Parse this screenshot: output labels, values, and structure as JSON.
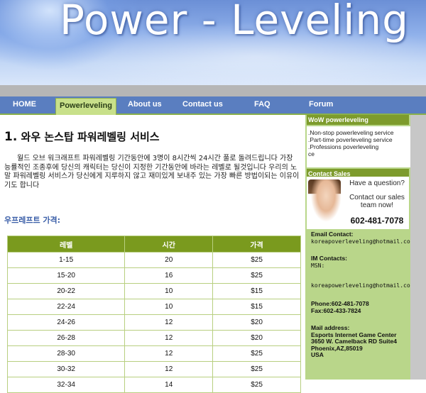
{
  "banner": {
    "title": "Power - Leveling"
  },
  "nav": {
    "home": "HOME",
    "powerleveling": "Powerleveling",
    "about": "About us",
    "contact": "Contact us",
    "faq": "FAQ",
    "forum": "Forum"
  },
  "main": {
    "heading_num": "1.",
    "heading": "와우 논스탑 파워레벨링 서비스",
    "paragraph": "월드 오브 워크래프트 파워레벨링 기간동안에 3명이 8시간씩 24시간 풀로 돌려드립니다 가장 능률적인 조종후에 당신의 캐릭터는 당신이 지정한 기간동안에 바라는 레벨로 될것입니다 우리의 노말 파워레벨링 서비스가 당신에게 지루하지 않고 재미있게 보내주 있는 가장 빠른 방법이되는 이유이기도 합니다",
    "price_heading": "우프레프트 가격:",
    "table": {
      "headers": [
        "레벨",
        "시간",
        "가격"
      ],
      "rows": [
        [
          "1-15",
          "20",
          "$25"
        ],
        [
          "15-20",
          "16",
          "$25"
        ],
        [
          "20-22",
          "10",
          "$15"
        ],
        [
          "22-24",
          "10",
          "$15"
        ],
        [
          "24-26",
          "12",
          "$20"
        ],
        [
          "26-28",
          "12",
          "$20"
        ],
        [
          "28-30",
          "12",
          "$25"
        ],
        [
          "30-32",
          "12",
          "$25"
        ],
        [
          "32-34",
          "14",
          "$25"
        ]
      ]
    }
  },
  "sidebar": {
    "wow_head": "WoW powerleveling",
    "links": [
      ".Non-stop powerleveling service",
      ".Part-time poverleveling service",
      ".Professions poverleveling",
      "ce"
    ],
    "contact_head": "Contact Sales",
    "contact_q": "Have a question?",
    "contact_msg": "Contact our sales team now!",
    "contact_phone": "602-481-7078",
    "email_label": "Email Contact:",
    "email_value": "koreapoverleveling@hotmail.com",
    "im_label": "IM Contacts:",
    "msn_label": "MSN:",
    "msn_value": "koreapowerleveling@hotmail.com",
    "phone_line": "Phone:602-481-7078",
    "fax_line": "Fax:602-433-7824",
    "mail_label": "Mail address:",
    "mail_name": "Esports Internet Game Center",
    "mail_street": "3650 W. Camelback RD Suite4",
    "mail_city": "Phoenix,AZ,85019",
    "mail_country": "USA"
  }
}
